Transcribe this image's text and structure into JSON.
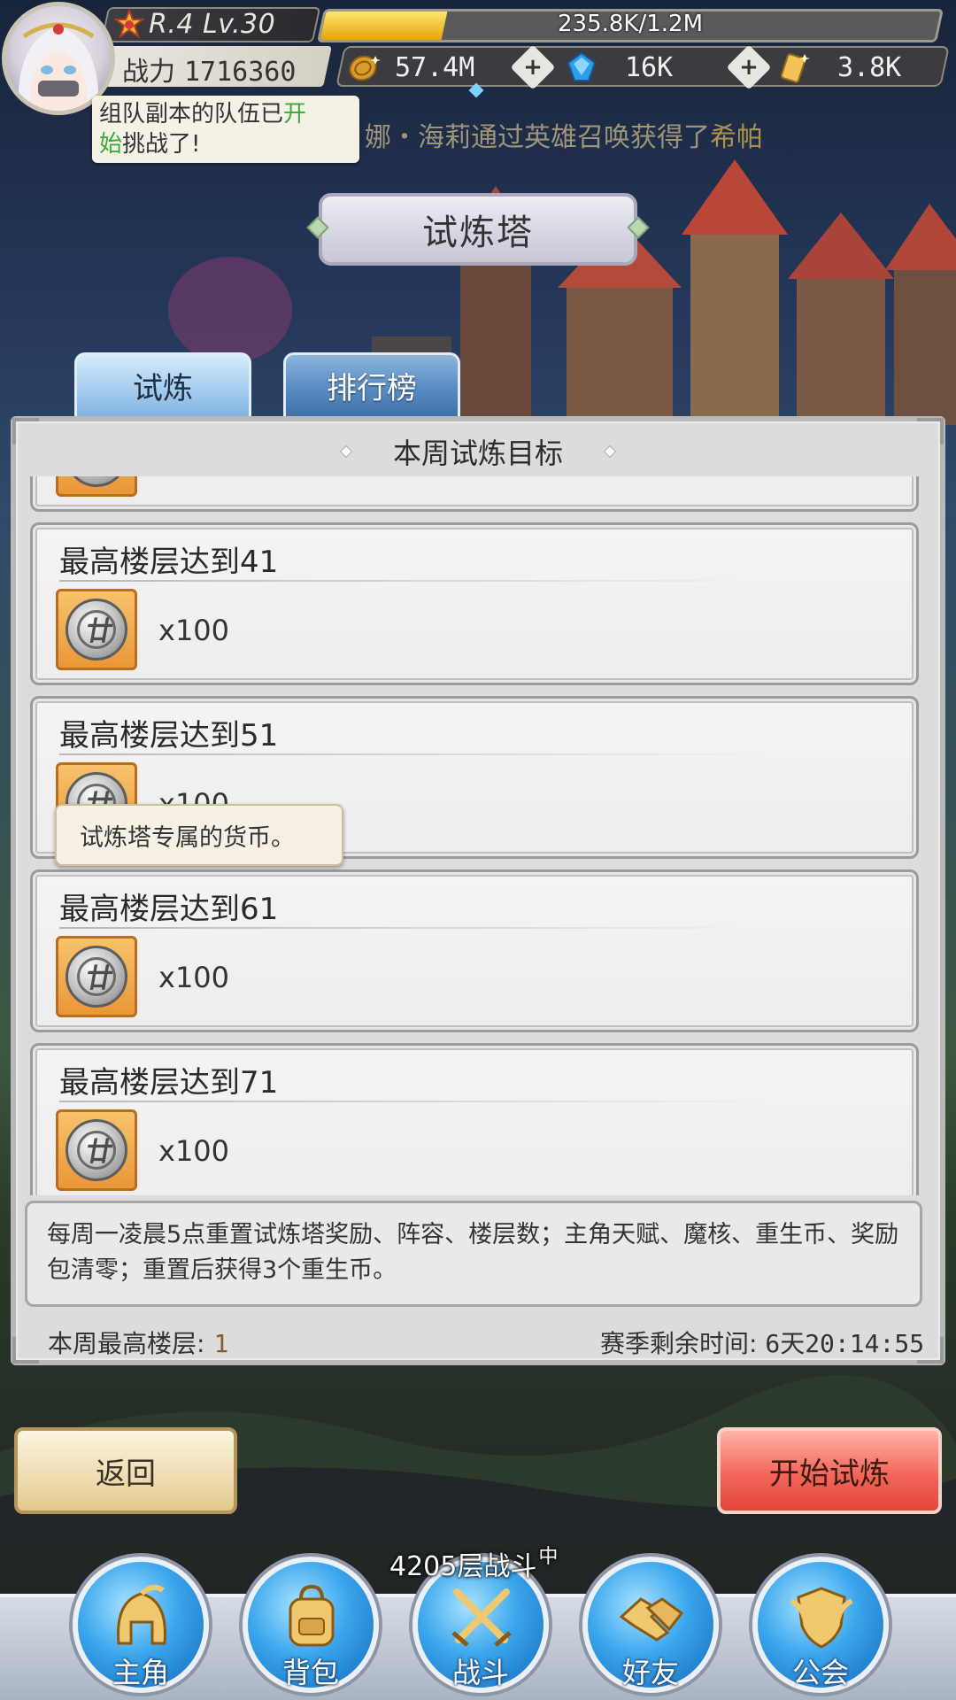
{
  "player": {
    "rank_level": "R.4 Lv.30",
    "exp_text": "235.8K/1.2M",
    "exp_fraction": 0.197,
    "power_label": "战力",
    "power_value": "1716360"
  },
  "resources": [
    {
      "icon": "gold-coin-icon",
      "value": "57.4M"
    },
    {
      "icon": "blue-diamond-icon",
      "value": "16K"
    },
    {
      "icon": "gold-ticket-icon",
      "value": "3.8K"
    }
  ],
  "notification": {
    "part1": "组队副本的队伍已",
    "highlight1": "开",
    "highlight2": "始",
    "part2": "挑战了!"
  },
  "ticker": {
    "text": "娜・海莉通过英雄召唤获得了",
    "gold_text": "希帕"
  },
  "page_title": "试炼塔",
  "tabs": [
    {
      "label": "试炼",
      "active": true
    },
    {
      "label": "排行榜",
      "active": false
    }
  ],
  "panel_header": "本周试炼目标",
  "goals": [
    {
      "title": "",
      "quantity": ""
    },
    {
      "title": "最高楼层达到41",
      "quantity": "x100"
    },
    {
      "title": "最高楼层达到51",
      "quantity": "x100"
    },
    {
      "title": "最高楼层达到61",
      "quantity": "x100"
    },
    {
      "title": "最高楼层达到71",
      "quantity": "x100"
    }
  ],
  "tooltip": "试炼塔专属的货币。",
  "info_text": "每周一凌晨5点重置试炼塔奖励、阵容、楼层数；主角天赋、魔核、重生币、奖励包清零；重置后获得3个重生币。",
  "weekly_highest_label": "本周最高楼层:",
  "weekly_highest_value": "1",
  "season_remaining_label": "赛季剩余时间:",
  "season_remaining_value": "6天20:14:55",
  "buttons": {
    "back": "返回",
    "start": "开始试炼"
  },
  "battle_status": {
    "text": "4205层战斗",
    "suffix": "中"
  },
  "nav": [
    {
      "label": "主角",
      "icon": "helmet-icon"
    },
    {
      "label": "背包",
      "icon": "backpack-icon"
    },
    {
      "label": "战斗",
      "icon": "crossed-swords-icon"
    },
    {
      "label": "好友",
      "icon": "handshake-icon"
    },
    {
      "label": "公会",
      "icon": "guild-shield-icon"
    }
  ],
  "colors": {
    "tab_blue": "#88b8e6",
    "start_button_red": "#f2675a",
    "back_button_gold": "#eedcb0",
    "exp_fill": "#e7a20f",
    "notify_highlight": "#3aaa3a"
  }
}
